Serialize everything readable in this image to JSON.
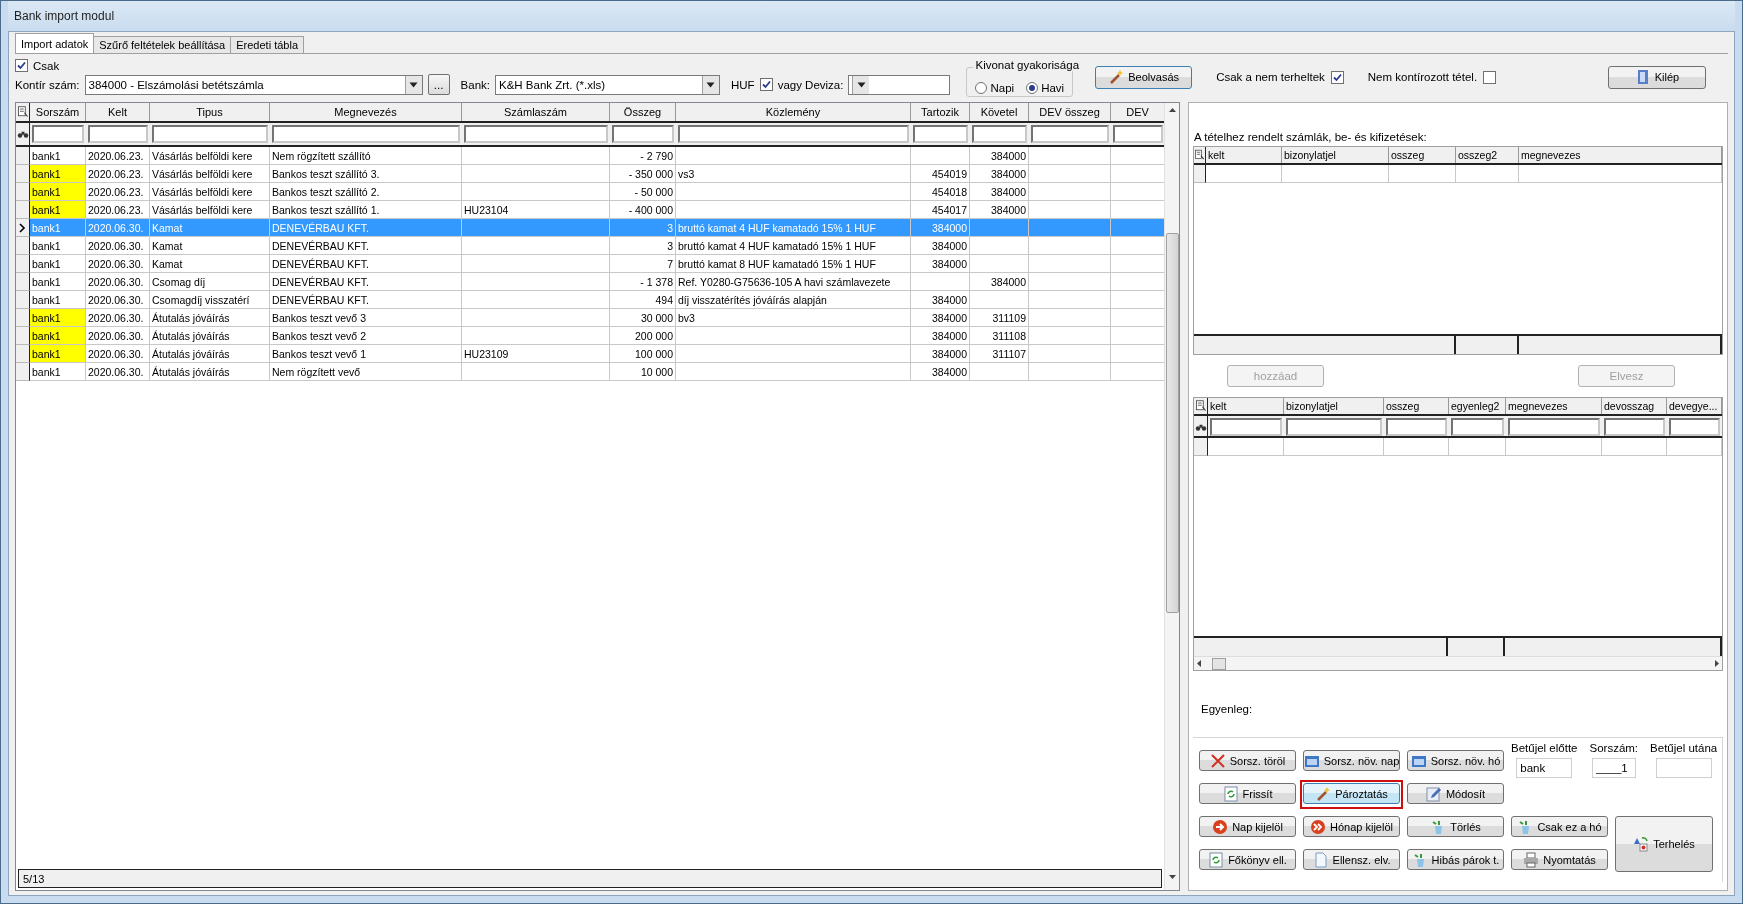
{
  "window": {
    "title": "Bank import modul"
  },
  "tabs": [
    {
      "label": "Import adatok",
      "selected": true
    },
    {
      "label": "Szűrő feltételek beállítása",
      "selected": false
    },
    {
      "label": "Eredeti tábla",
      "selected": false
    }
  ],
  "toolbar": {
    "only_checkbox": {
      "label": "Csak",
      "checked": true
    },
    "account": {
      "label": "Kontír szám:",
      "value": "384000 - Elszámolási betétszámla"
    },
    "browse_button": "...",
    "bank": {
      "label": "Bank:",
      "value": "K&H Bank Zrt. (*.xls)"
    },
    "huf": {
      "label": "HUF",
      "checked": true
    },
    "currency": {
      "label": "vagy Deviza:"
    },
    "frequency": {
      "title": "Kivonat gyakorisága",
      "options": [
        {
          "label": "Napi",
          "selected": false
        },
        {
          "label": "Havi",
          "selected": true
        }
      ]
    },
    "read_button": "Beolvasás",
    "unbooked_only": {
      "label": "Csak a nem terheltek",
      "checked": true
    },
    "not_posted": {
      "label": "Nem kontírozott tétel.",
      "checked": false
    },
    "exit_button": "Kilép"
  },
  "main_table": {
    "columns": [
      "Sorszám",
      "Kelt",
      "Tipus",
      "Megnevezés",
      "Számlaszám",
      "Összeg",
      "Közlemény",
      "Tartozik",
      "Követel",
      "DEV összeg",
      "DEV"
    ],
    "rows": [
      {
        "sorszam": "bank1",
        "kelt": "2020.06.23.",
        "tipus": "Vásárlás belföldi kere",
        "megnevezes": "Nem rögzített szállító",
        "osszeg": "- 2 790",
        "kovetel": "384000",
        "highlighted": false,
        "selected": false
      },
      {
        "sorszam": "bank1",
        "kelt": "2020.06.23.",
        "tipus": "Vásárlás belföldi kere",
        "megnevezes": "Bankos teszt szállító 3.",
        "osszeg": "- 350 000",
        "kozlemeny": "vs3",
        "tartozik": "454019",
        "kovetel": "384000",
        "highlighted": true,
        "selected": false
      },
      {
        "sorszam": "bank1",
        "kelt": "2020.06.23.",
        "tipus": "Vásárlás belföldi kere",
        "megnevezes": "Bankos teszt szállító 2.",
        "osszeg": "- 50 000",
        "tartozik": "454018",
        "kovetel": "384000",
        "highlighted": true,
        "selected": false
      },
      {
        "sorszam": "bank1",
        "kelt": "2020.06.23.",
        "tipus": "Vásárlás belföldi kere",
        "megnevezes": "Bankos teszt szállító 1.",
        "szamlaszam": "HU23104",
        "osszeg": "- 400 000",
        "tartozik": "454017",
        "kovetel": "384000",
        "highlighted": true,
        "selected": false
      },
      {
        "sorszam": "bank1",
        "kelt": "2020.06.30.",
        "tipus": "Kamat",
        "megnevezes": "DENEVÉRBAU KFT.",
        "osszeg": "3",
        "kozlemeny": "bruttó kamat 4 HUF kamatadó 15% 1 HUF",
        "tartozik": "384000",
        "highlighted": false,
        "selected": true
      },
      {
        "sorszam": "bank1",
        "kelt": "2020.06.30.",
        "tipus": "Kamat",
        "megnevezes": "DENEVÉRBAU KFT.",
        "osszeg": "3",
        "kozlemeny": "bruttó kamat 4 HUF kamatadó 15% 1 HUF",
        "tartozik": "384000",
        "highlighted": false,
        "selected": false
      },
      {
        "sorszam": "bank1",
        "kelt": "2020.06.30.",
        "tipus": "Kamat",
        "megnevezes": "DENEVÉRBAU KFT.",
        "osszeg": "7",
        "kozlemeny": "bruttó kamat 8 HUF kamatadó 15% 1 HUF",
        "tartozik": "384000",
        "highlighted": false,
        "selected": false
      },
      {
        "sorszam": "bank1",
        "kelt": "2020.06.30.",
        "tipus": "Csomag díj",
        "megnevezes": "DENEVÉRBAU KFT.",
        "osszeg": "- 1 378",
        "kozlemeny": "Ref. Y0280-G75636-105 A havi számlavezete",
        "kovetel": "384000",
        "highlighted": false,
        "selected": false
      },
      {
        "sorszam": "bank1",
        "kelt": "2020.06.30.",
        "tipus": "Csomagdíj visszatérí",
        "megnevezes": "DENEVÉRBAU KFT.",
        "osszeg": "494",
        "kozlemeny": "díj visszatérítés jóváírás alapján",
        "tartozik": "384000",
        "highlighted": false,
        "selected": false
      },
      {
        "sorszam": "bank1",
        "kelt": "2020.06.30.",
        "tipus": "Átutalás jóváírás",
        "megnevezes": "Bankos teszt vevő 3",
        "osszeg": "30 000",
        "kozlemeny": "bv3",
        "tartozik": "384000",
        "kovetel": "311109",
        "highlighted": true,
        "selected": false
      },
      {
        "sorszam": "bank1",
        "kelt": "2020.06.30.",
        "tipus": "Átutalás jóváírás",
        "megnevezes": "Bankos teszt vevő 2",
        "osszeg": "200 000",
        "tartozik": "384000",
        "kovetel": "311108",
        "highlighted": true,
        "selected": false
      },
      {
        "sorszam": "bank1",
        "kelt": "2020.06.30.",
        "tipus": "Átutalás jóváírás",
        "megnevezes": "Bankos teszt vevő 1",
        "szamlaszam": "HU23109",
        "osszeg": "100 000",
        "tartozik": "384000",
        "kovetel": "311107",
        "highlighted": true,
        "selected": false
      },
      {
        "sorszam": "bank1",
        "kelt": "2020.06.30.",
        "tipus": "Átutalás jóváírás",
        "megnevezes": "Nem rögzített vevő",
        "osszeg": "10 000",
        "tartozik": "384000",
        "highlighted": false,
        "selected": false
      }
    ],
    "status": "5/13"
  },
  "right_panel": {
    "assigned_label": "A tételhez rendelt számlák, be- és kifizetések:",
    "assigned_table": {
      "columns": [
        "kelt",
        "bizonylatjel",
        "osszeg",
        "osszeg2",
        "megnevezes"
      ]
    },
    "add_button": {
      "label": "hozzáad",
      "disabled": true
    },
    "remove_button": {
      "label": "Elvesz",
      "disabled": true
    },
    "open_table": {
      "columns": [
        "kelt",
        "bizonylatjel",
        "osszeg",
        "egyenleg2",
        "megnevezes",
        "devosszag",
        "devegye..."
      ]
    },
    "balance_label": "Egyenleg:",
    "actions": [
      {
        "label": "Sorsz. töröl",
        "highlighted": false
      },
      {
        "label": "Sorsz. növ. nap",
        "highlighted": false
      },
      {
        "label": "Sorsz. növ. hó",
        "highlighted": false
      },
      {
        "label": "Frissít",
        "highlighted": false
      },
      {
        "label": "Pároztatás",
        "highlighted": true
      },
      {
        "label": "Módosít",
        "highlighted": false
      },
      {
        "label": "Nap kijelöl",
        "highlighted": false
      },
      {
        "label": "Hónap kijelöl",
        "highlighted": false
      },
      {
        "label": "Törlés",
        "highlighted": false
      },
      {
        "label": "Csak ez a hó",
        "highlighted": false
      },
      {
        "label": "Főkönyv ell.",
        "highlighted": false
      },
      {
        "label": "Ellensz. elv.",
        "highlighted": false
      },
      {
        "label": "Hibás párok t.",
        "highlighted": false
      },
      {
        "label": "Nyomtatás",
        "highlighted": false
      }
    ],
    "prefix": {
      "label": "Betűjel előtte",
      "value": "bank"
    },
    "number": {
      "label": "Sorszám:",
      "value": "____1"
    },
    "suffix": {
      "label": "Betűjel utána"
    },
    "charge_button": "Terhelés"
  }
}
